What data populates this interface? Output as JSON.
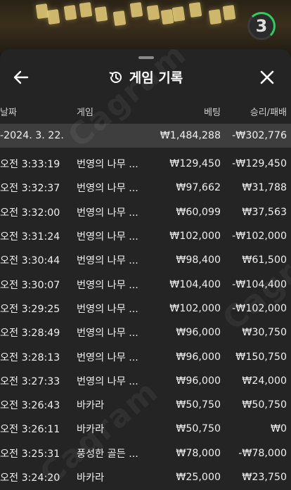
{
  "timer": {
    "value": "3"
  },
  "header": {
    "title": "게임 기록"
  },
  "columns": {
    "date": "날짜",
    "game": "게임",
    "bet": "베팅",
    "result": "승리/패배"
  },
  "summary": {
    "date": "-2024. 3. 22.",
    "bet": "₩1,484,288",
    "result": "-₩302,776"
  },
  "rows": [
    {
      "time": "오전 3:33:19",
      "game": "번영의 나무 ...",
      "bet": "₩129,450",
      "result": "-₩129,450"
    },
    {
      "time": "오전 3:32:37",
      "game": "번영의 나무 ...",
      "bet": "₩97,662",
      "result": "₩31,788"
    },
    {
      "time": "오전 3:32:00",
      "game": "번영의 나무 ...",
      "bet": "₩60,099",
      "result": "₩37,563"
    },
    {
      "time": "오전 3:31:24",
      "game": "번영의 나무 ...",
      "bet": "₩102,000",
      "result": "-₩102,000"
    },
    {
      "time": "오전 3:30:44",
      "game": "번영의 나무 ...",
      "bet": "₩98,400",
      "result": "₩61,500"
    },
    {
      "time": "오전 3:30:07",
      "game": "번영의 나무 ...",
      "bet": "₩104,400",
      "result": "-₩104,400"
    },
    {
      "time": "오전 3:29:25",
      "game": "번영의 나무 ...",
      "bet": "₩102,000",
      "result": "-₩102,000"
    },
    {
      "time": "오전 3:28:49",
      "game": "번영의 나무 ...",
      "bet": "₩96,000",
      "result": "₩30,750"
    },
    {
      "time": "오전 3:28:13",
      "game": "번영의 나무 ...",
      "bet": "₩96,000",
      "result": "₩150,750"
    },
    {
      "time": "오전 3:27:33",
      "game": "번영의 나무 ...",
      "bet": "₩96,000",
      "result": "₩24,000"
    },
    {
      "time": "오전 3:26:43",
      "game": "바카라",
      "bet": "₩50,750",
      "result": "₩50,750"
    },
    {
      "time": "오전 3:26:11",
      "game": "바카라",
      "bet": "₩50,750",
      "result": "₩0"
    },
    {
      "time": "오전 3:25:31",
      "game": "풍성한 골든 ...",
      "bet": "₩78,000",
      "result": "-₩78,000"
    },
    {
      "time": "오전 3:24:20",
      "game": "바카라",
      "bet": "₩25,000",
      "result": "₩23,750"
    }
  ],
  "watermark": "Cagram",
  "icons": {
    "back": "arrow-left-icon",
    "history": "history-icon",
    "close": "close-icon"
  }
}
